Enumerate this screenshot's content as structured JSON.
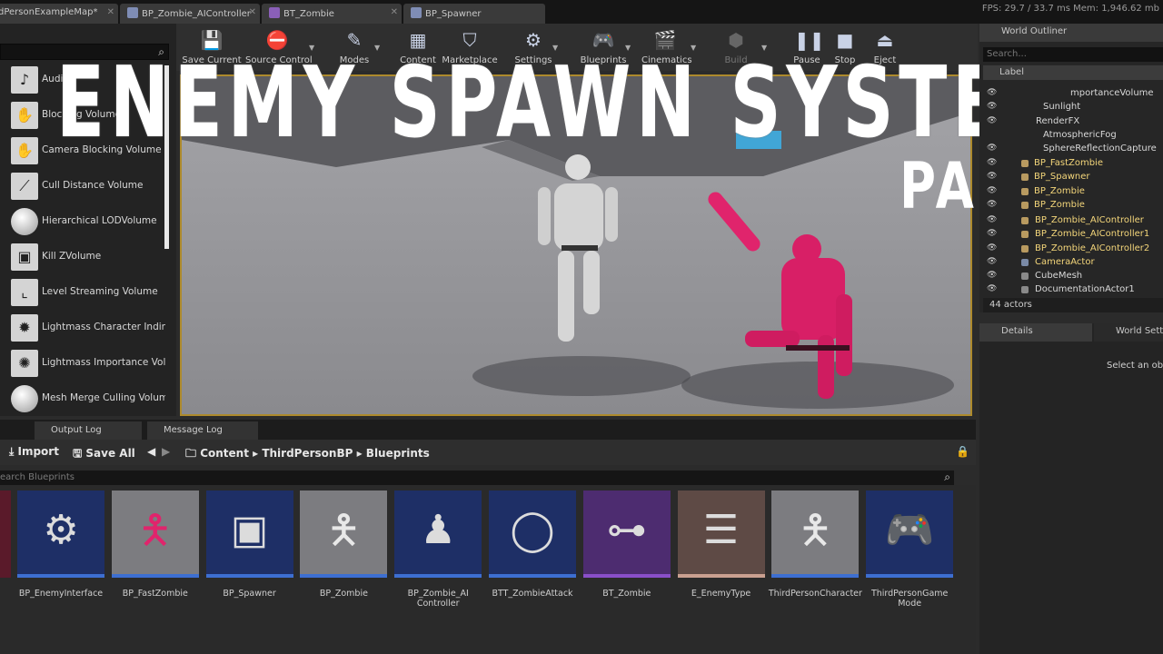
{
  "document_tabs": [
    {
      "label": "dPersonExampleMap*"
    },
    {
      "label": "BP_Zombie_AIController"
    },
    {
      "label": "BT_Zombie"
    },
    {
      "label": "BP_Spawner"
    }
  ],
  "stats": {
    "text": "FPS: 29.7  /  33.7 ms   Mem: 1,946.62 mb"
  },
  "modes_panel": {
    "items": [
      {
        "label": "Audio",
        "icon": "audio-volume-icon"
      },
      {
        "label": "Blocking Volume",
        "icon": "hand-icon"
      },
      {
        "label": "Camera Blocking Volume",
        "icon": "camera-blocking-icon"
      },
      {
        "label": "Cull Distance Volume",
        "icon": "cull-distance-icon"
      },
      {
        "label": "Hierarchical LODVolume",
        "icon": "sphere-icon"
      },
      {
        "label": "Kill ZVolume",
        "icon": "kill-z-icon"
      },
      {
        "label": "Level Streaming Volume",
        "icon": "level-streaming-icon"
      },
      {
        "label": "Lightmass Character Indire",
        "icon": "light-icon"
      },
      {
        "label": "Lightmass Importance Volu",
        "icon": "light-importance-icon"
      },
      {
        "label": "Mesh Merge Culling Volume",
        "icon": "sphere-icon"
      }
    ]
  },
  "toolbar": {
    "buttons": [
      {
        "label": "Save Current",
        "icon": "save-icon"
      },
      {
        "label": "Source Control",
        "icon": "source-control-icon"
      },
      {
        "label": "Modes",
        "icon": "modes-icon"
      },
      {
        "label": "Content",
        "icon": "content-icon"
      },
      {
        "label": "Marketplace",
        "icon": "marketplace-icon"
      },
      {
        "label": "Settings",
        "icon": "settings-icon"
      },
      {
        "label": "Blueprints",
        "icon": "blueprints-icon"
      },
      {
        "label": "Cinematics",
        "icon": "cinematics-icon"
      },
      {
        "label": "Build",
        "icon": "build-icon"
      },
      {
        "label": "Pause",
        "icon": "pause-icon"
      },
      {
        "label": "Stop",
        "icon": "stop-icon"
      },
      {
        "label": "Eject",
        "icon": "eject-icon"
      }
    ]
  },
  "overlay": {
    "title": "ENEMY SPAWN SYSTEM",
    "subtitle": "PART I"
  },
  "world_outliner": {
    "tab_label": "World Outliner",
    "search_placeholder": "Search...",
    "header_label": "Label",
    "rows": [
      {
        "label": "mportanceVolume",
        "kind": "plain"
      },
      {
        "label": "Sunlight",
        "kind": "plain"
      },
      {
        "label": "RenderFX",
        "kind": "plain"
      },
      {
        "label": "AtmosphericFog",
        "kind": "plain"
      },
      {
        "label": "SphereReflectionCapture",
        "kind": "plain"
      },
      {
        "label": "BP_FastZombie",
        "kind": "bp"
      },
      {
        "label": "BP_Spawner",
        "kind": "bp"
      },
      {
        "label": "BP_Zombie",
        "kind": "bp"
      },
      {
        "label": "BP_Zombie",
        "kind": "bp"
      },
      {
        "label": "BP_Zombie_AIController",
        "kind": "bp"
      },
      {
        "label": "BP_Zombie_AIController1",
        "kind": "bp"
      },
      {
        "label": "BP_Zombie_AIController2",
        "kind": "bp"
      },
      {
        "label": "CameraActor",
        "kind": "bp"
      },
      {
        "label": "CubeMesh",
        "kind": "plain"
      },
      {
        "label": "DocumentationActor1",
        "kind": "plain"
      }
    ],
    "actor_count": "44 actors"
  },
  "details": {
    "tab_label": "Details",
    "world_settings_label": "World Settings",
    "hint": "Select an object"
  },
  "bottom_tabs": [
    {
      "label": "Output Log"
    },
    {
      "label": "Message Log"
    }
  ],
  "content_browser": {
    "import_label": "Import",
    "save_all_label": "Save All",
    "breadcrumb": [
      "Content",
      "ThirdPersonBP",
      "Blueprints"
    ],
    "search_placeholder": "earch Blueprints",
    "assets": [
      {
        "label": "BP_EnemyInterface",
        "strip": "#3d6fd1",
        "bg": "#1e2f66",
        "icon": "interface-icon"
      },
      {
        "label": "BP_FastZombie",
        "strip": "#3d6fd1",
        "bg": "#7c7c80",
        "icon": "pink-mannequin-icon"
      },
      {
        "label": "BP_Spawner",
        "strip": "#3d6fd1",
        "bg": "#1e2f66",
        "icon": "cube-icon"
      },
      {
        "label": "BP_Zombie",
        "strip": "#3d6fd1",
        "bg": "#7c7c80",
        "icon": "white-mannequin-icon"
      },
      {
        "label": "BP_Zombie_AI Controller",
        "strip": "#3d6fd1",
        "bg": "#1e2f66",
        "icon": "ai-controller-icon"
      },
      {
        "label": "BTT_ZombieAttack",
        "strip": "#3d6fd1",
        "bg": "#1e2f66",
        "icon": "ring-icon"
      },
      {
        "label": "BT_Zombie",
        "strip": "#8a4fc8",
        "bg": "#4d2c70",
        "icon": "tree-icon"
      },
      {
        "label": "E_EnemyType",
        "strip": "#c9a090",
        "bg": "#5e4a45",
        "icon": "enum-list-icon"
      },
      {
        "label": "ThirdPersonCharacter",
        "strip": "#3d6fd1",
        "bg": "#7c7c80",
        "icon": "white-mannequin-icon"
      },
      {
        "label": "ThirdPersonGame Mode",
        "strip": "#3d6fd1",
        "bg": "#1e2f66",
        "icon": "gamepad-icon"
      }
    ]
  }
}
